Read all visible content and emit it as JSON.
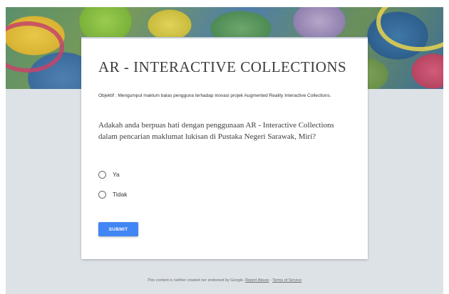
{
  "form": {
    "title": "AR - INTERACTIVE COLLECTIONS",
    "description": "Objektif : Mengumpul maklum balas pengguna terhadap inovasi projek Augmented Reality Interactive Collections.",
    "question": "Adakah anda berpuas hati dengan penggunaan AR - Interactive Collections dalam pencarian maklumat lukisan di Pustaka Negeri Sarawak, Miri?",
    "options": [
      {
        "label": "Ya"
      },
      {
        "label": "Tidak"
      }
    ],
    "submit_label": "SUBMIT"
  },
  "footer": {
    "text": "This content is neither created nor endorsed by Google.",
    "report_abuse": "Report Abuse",
    "separator": "-",
    "terms": "Terms of Service"
  },
  "colors": {
    "page_background": "#dde2e6",
    "submit_button": "#4285f4"
  }
}
